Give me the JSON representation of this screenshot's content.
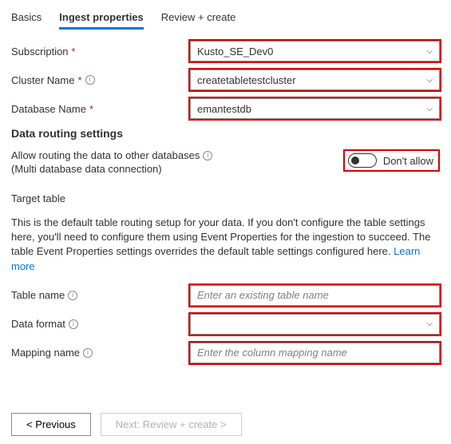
{
  "tabs": {
    "basics": "Basics",
    "ingest": "Ingest properties",
    "review": "Review + create"
  },
  "subscription": {
    "label": "Subscription",
    "value": "Kusto_SE_Dev0"
  },
  "cluster": {
    "label": "Cluster Name",
    "value": "createtabletestcluster"
  },
  "database": {
    "label": "Database Name",
    "value": "emantestdb"
  },
  "routing": {
    "section_title": "Data routing settings",
    "allow_label": "Allow routing the data to other databases",
    "allow_sub": "(Multi database data connection)",
    "toggle_text": "Don't allow"
  },
  "target": {
    "title": "Target table",
    "desc_part1": "This is the default table routing setup for your data. If you don't configure the table settings here, you'll need to configure them using Event Properties for the ingestion to succeed. The table Event Properties settings overrides the default table settings configured here. ",
    "learn_more": "Learn more"
  },
  "table_name": {
    "label": "Table name",
    "placeholder": "Enter an existing table name"
  },
  "data_format": {
    "label": "Data format",
    "value": ""
  },
  "mapping": {
    "label": "Mapping name",
    "placeholder": "Enter the column mapping name"
  },
  "footer": {
    "prev": "<  Previous",
    "next": "Next: Review + create  >"
  }
}
